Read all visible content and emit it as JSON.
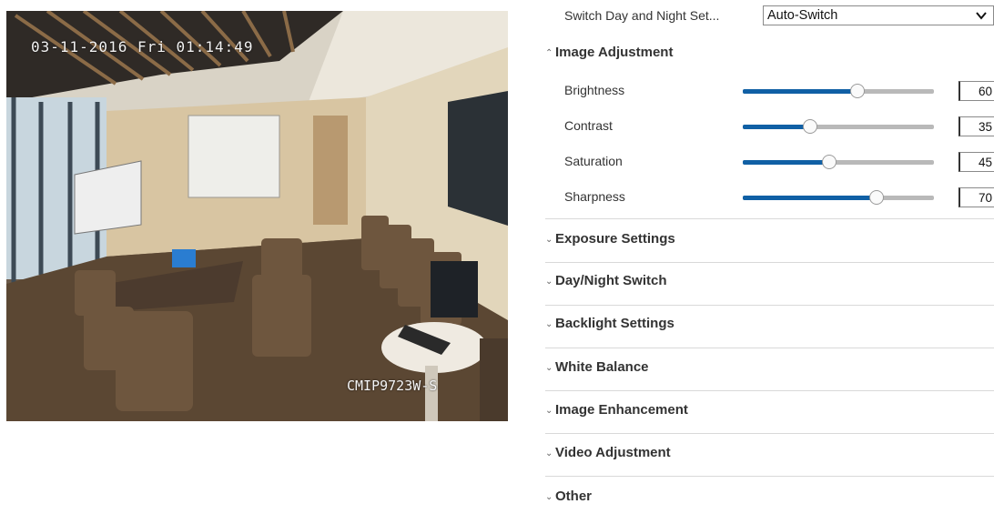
{
  "preview": {
    "osd_time": "03-11-2016 Fri 01:14:49",
    "osd_name": "CMIP9723W-S"
  },
  "switch_day_night": {
    "label": "Switch Day and Night Set...",
    "value": "Auto-Switch"
  },
  "image_adjustment": {
    "title": "Image Adjustment",
    "sliders": [
      {
        "label": "Brightness",
        "value": 60
      },
      {
        "label": "Contrast",
        "value": 35
      },
      {
        "label": "Saturation",
        "value": 45
      },
      {
        "label": "Sharpness",
        "value": 70
      }
    ]
  },
  "sections": [
    {
      "title": "Exposure Settings"
    },
    {
      "title": "Day/Night Switch"
    },
    {
      "title": "Backlight Settings"
    },
    {
      "title": "White Balance"
    },
    {
      "title": "Image Enhancement"
    },
    {
      "title": "Video Adjustment"
    },
    {
      "title": "Other"
    }
  ],
  "colors": {
    "accent": "#1060a5",
    "track": "#b9b9b9",
    "divider": "#d9d9d9"
  }
}
